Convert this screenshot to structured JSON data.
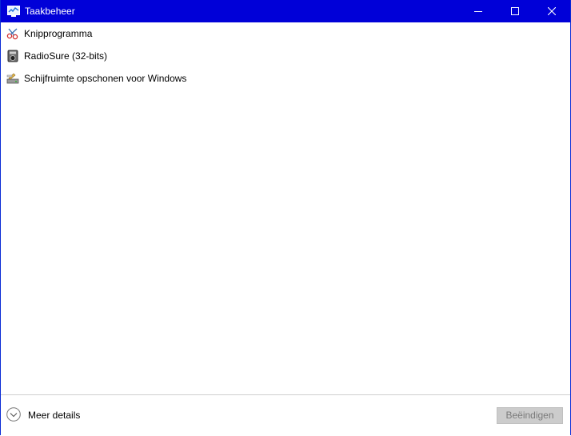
{
  "window": {
    "title": "Taakbeheer",
    "icon": "task-manager-icon",
    "controls": {
      "minimize": "minimize-icon",
      "maximize": "maximize-icon",
      "close": "close-icon"
    }
  },
  "tasks": [
    {
      "label": "Knipprogramma",
      "icon": "snipping-tool-icon"
    },
    {
      "label": "RadioSure (32-bits)",
      "icon": "radio-icon"
    },
    {
      "label": "Schijfruimte opschonen voor Windows",
      "icon": "disk-cleanup-icon"
    }
  ],
  "footer": {
    "more_details": "Meer details",
    "more_details_icon": "chevron-down-icon",
    "end_task": "Beëindigen",
    "end_task_disabled": true
  },
  "colors": {
    "titlebar": "#0000d8",
    "window_border": "#0a2cd6",
    "button_disabled_bg": "#cccccc",
    "button_disabled_text": "#7a7a7a"
  }
}
